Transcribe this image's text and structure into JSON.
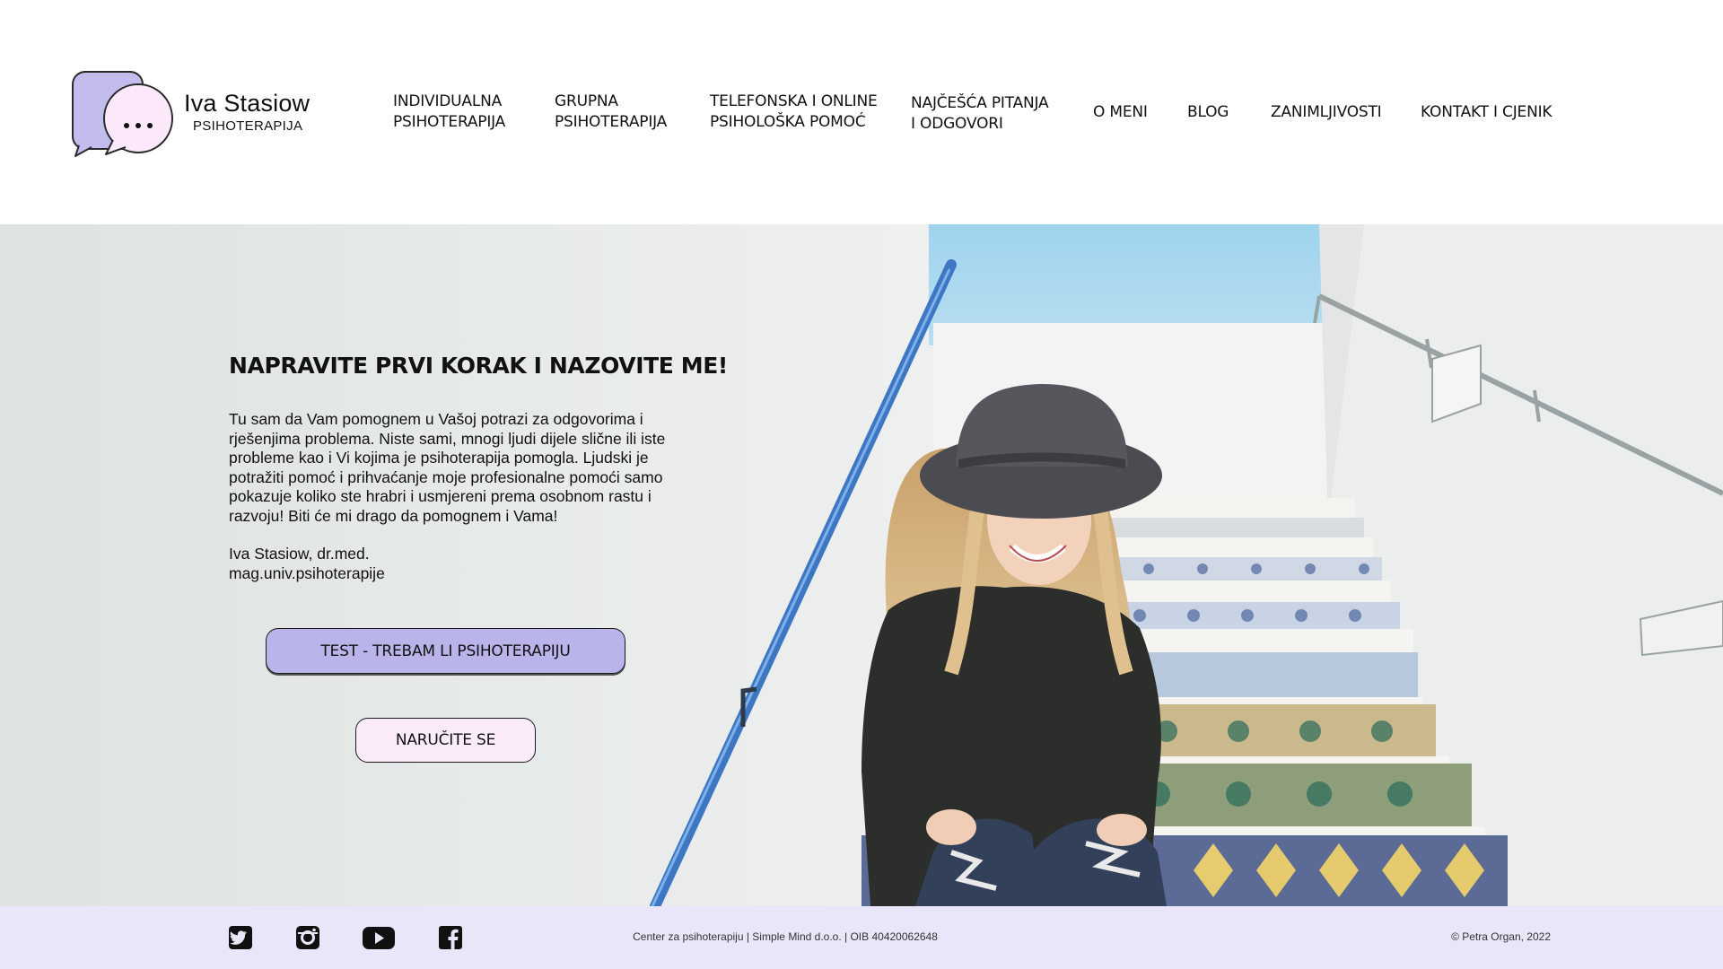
{
  "brand": {
    "name": "Iva Stasiow",
    "subtitle": "PSIHOTERAPIJA",
    "logo_icon": "speech-bubbles-icon",
    "colors": {
      "lavender": "#b9b4ea",
      "pink": "#fbebfb",
      "footer_bg": "#e8e6f8"
    }
  },
  "nav": {
    "items": [
      {
        "label": "INDIVIDUALNA\nPSIHOTERAPIJA"
      },
      {
        "label": "GRUPNA\nPSIHOTERAPIJA"
      },
      {
        "label": "TELEFONSKA I ONLINE\nPSIHOLOŠKA POMOĆ"
      },
      {
        "label": "NAJČEŠĆA PITANJA\nI ODGOVORI"
      },
      {
        "label": "O MENI"
      },
      {
        "label": "BLOG"
      },
      {
        "label": "ZANIMLJIVOSTI"
      },
      {
        "label": "KONTAKT I CJENIK"
      }
    ]
  },
  "hero": {
    "title": "NAPRAVITE PRVI KORAK I NAZOVITE ME!",
    "text": "Tu sam da Vam pomognem u Vašoj potrazi za odgovorima i rješenjima problema. Niste sami, mnogi ljudi dijele slične ili iste probleme kao i Vi kojima je psihoterapija pomogla. Ljudski je potražiti pomoć i prihvaćanje moje profesionalne pomoći samo pokazuje koliko ste hrabri i usmjereni prema osobnom rastu i razvoju! Biti će mi drago da pomognem i Vama!",
    "signature_name": "Iva Stasiow, dr.med.",
    "signature_title": "mag.univ.psihoterapije",
    "test_button": "TEST - TREBAM LI PSIHOTERAPIJU",
    "order_button": "NARUČITE SE"
  },
  "footer": {
    "social": [
      "twitter-icon",
      "instagram-icon",
      "youtube-icon",
      "facebook-icon"
    ],
    "center_text": "Center za psihoterapiju | Simple Mind d.o.o. | OIB 40420062648",
    "copyright": "© Petra Organ, 2022"
  }
}
